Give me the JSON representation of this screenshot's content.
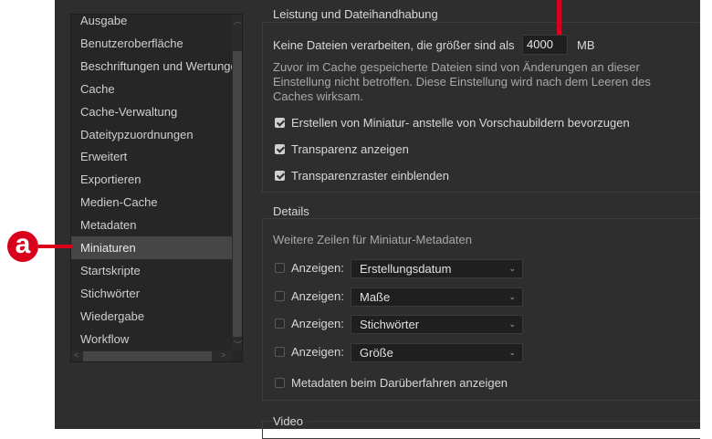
{
  "sidebar": {
    "items": [
      "Ausgabe",
      "Benutzeroberfläche",
      "Beschriftungen und Wertungen",
      "Cache",
      "Cache-Verwaltung",
      "Dateitypzuordnungen",
      "Erweitert",
      "Exportieren",
      "Medien-Cache",
      "Metadaten",
      "Miniaturen",
      "Startskripte",
      "Stichwörter",
      "Wiedergabe",
      "Workflow"
    ],
    "selected": "Miniaturen"
  },
  "annotation": {
    "label": "a",
    "color": "#d9001b"
  },
  "performance": {
    "title": "Leistung und Dateihandhabung",
    "max_size_label": "Keine Dateien verarbeiten, die größer sind als",
    "max_size_value": "4000",
    "max_size_unit": "MB",
    "note": [
      "Zuvor im Cache gespeicherte Dateien sind von Änderungen an dieser",
      "Einstellung nicht betroffen. Diese Einstellung wird nach dem Leeren des",
      "Caches wirksam."
    ],
    "checkboxes": [
      {
        "label": "Erstellen von Miniatur- anstelle von Vorschaubildern bevorzugen",
        "checked": true
      },
      {
        "label": "Transparenz anzeigen",
        "checked": true
      },
      {
        "label": "Transparenzraster einblenden",
        "checked": true
      }
    ]
  },
  "details": {
    "title": "Details",
    "subtitle": "Weitere Zeilen für Miniatur-Metadaten",
    "rows": [
      {
        "label": "Anzeigen:",
        "value": "Erstellungsdatum",
        "checked": false
      },
      {
        "label": "Anzeigen:",
        "value": "Maße",
        "checked": false
      },
      {
        "label": "Anzeigen:",
        "value": "Stichwörter",
        "checked": false
      },
      {
        "label": "Anzeigen:",
        "value": "Größe",
        "checked": false
      }
    ],
    "hover_label": "Metadaten beim Darüberfahren anzeigen",
    "hover_checked": false
  },
  "video": {
    "title": "Video"
  }
}
